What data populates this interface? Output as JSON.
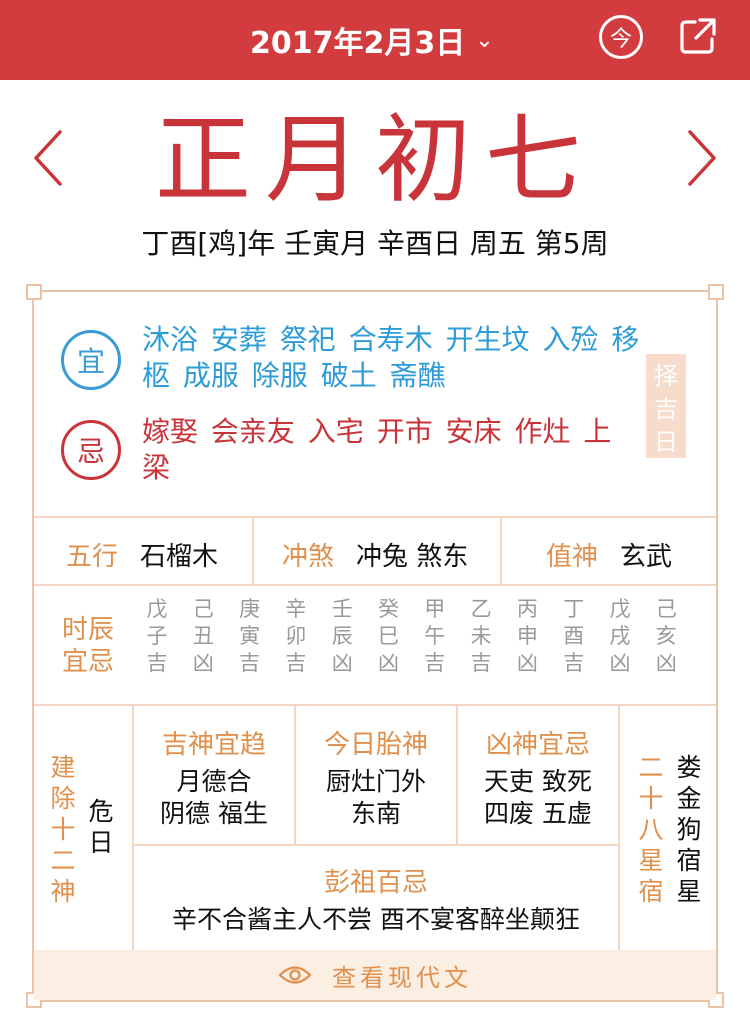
{
  "header": {
    "date": "2017年2月3日",
    "today_label": "今"
  },
  "lunar_date": "正月初七",
  "ganzhi": "丁酉[鸡]年 壬寅月 辛酉日  周五  第5周",
  "yi": {
    "badge": "宜",
    "items": "沐浴 安葬 祭祀 合寿木 开生坟 入殓 移柩 成服 除服 破土 斋醮"
  },
  "ji": {
    "badge": "忌",
    "items": "嫁娶 会亲友 入宅 开市 安床 作灶 上梁"
  },
  "zeji_label": [
    "择",
    "吉",
    "日"
  ],
  "wuxing": {
    "label": "五行",
    "value": "石榴木"
  },
  "chongsha": {
    "label": "冲煞",
    "value": "冲兔 煞东"
  },
  "zhishen": {
    "label": "值神",
    "value": "玄武"
  },
  "shichen": {
    "label": [
      "时辰",
      "宜忌"
    ],
    "hours": [
      [
        "戊",
        "子",
        "吉"
      ],
      [
        "己",
        "丑",
        "凶"
      ],
      [
        "庚",
        "寅",
        "吉"
      ],
      [
        "辛",
        "卯",
        "吉"
      ],
      [
        "壬",
        "辰",
        "凶"
      ],
      [
        "癸",
        "巳",
        "凶"
      ],
      [
        "甲",
        "午",
        "吉"
      ],
      [
        "乙",
        "未",
        "吉"
      ],
      [
        "丙",
        "申",
        "凶"
      ],
      [
        "丁",
        "酉",
        "吉"
      ],
      [
        "戊",
        "戌",
        "凶"
      ],
      [
        "己",
        "亥",
        "凶"
      ]
    ]
  },
  "jianchu": {
    "label": [
      "建",
      "除",
      "十",
      "二",
      "神"
    ],
    "value": [
      "危",
      "日"
    ]
  },
  "jishen": {
    "title": "吉神宜趋",
    "lines": [
      "月德合",
      "阴德 福生"
    ]
  },
  "taishen": {
    "title": "今日胎神",
    "lines": [
      "厨灶门外",
      "东南"
    ]
  },
  "xiongshen": {
    "title": "凶神宜忌",
    "lines": [
      "天吏 致死",
      "四废 五虚"
    ]
  },
  "xingxiu": {
    "label": [
      "二",
      "十",
      "八",
      "星",
      "宿"
    ],
    "value": [
      "娄",
      "金",
      "狗",
      "宿",
      "星"
    ]
  },
  "pengzu": {
    "title": "彭祖百忌",
    "text": "辛不合酱主人不尝 酉不宴客醉坐颠狂"
  },
  "footer_label": "查看现代文",
  "colors": {
    "header": "#d23c3e",
    "lunar": "#c9343a",
    "yi": "#2e9cd7",
    "ji": "#c9343a",
    "accent": "#e0904c",
    "border": "#ecc3a6"
  }
}
